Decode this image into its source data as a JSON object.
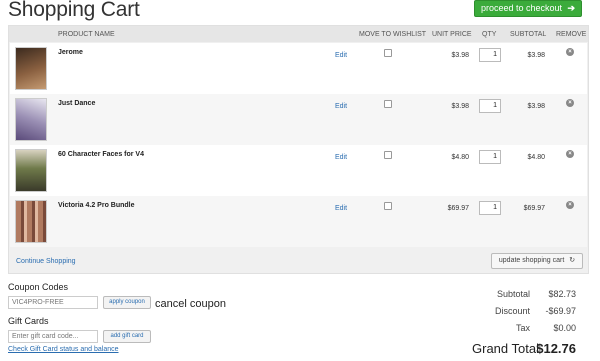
{
  "header": {
    "title": "Shopping Cart",
    "checkout_label": "proceed to checkout",
    "checkout_arrow": "➔"
  },
  "table": {
    "columns": {
      "product": "PRODUCT NAME",
      "wishlist": "MOVE TO WISHLIST",
      "unit_price": "UNIT PRICE",
      "qty": "QTY",
      "subtotal": "SUBTOTAL",
      "remove": "REMOVE"
    },
    "items": [
      {
        "name": "Jerome",
        "edit": "Edit",
        "unit_price": "$3.98",
        "qty": "1",
        "subtotal": "$3.98",
        "thumb_color": "#7a5a3c"
      },
      {
        "name": "Just Dance",
        "edit": "Edit",
        "unit_price": "$3.98",
        "qty": "1",
        "subtotal": "$3.98",
        "thumb_color": "#9a8fb4"
      },
      {
        "name": "60 Character Faces for V4",
        "edit": "Edit",
        "unit_price": "$4.80",
        "qty": "1",
        "subtotal": "$4.80",
        "thumb_color": "#6f7a4a"
      },
      {
        "name": "Victoria 4.2 Pro Bundle",
        "edit": "Edit",
        "unit_price": "$69.97",
        "qty": "1",
        "subtotal": "$69.97",
        "thumb_color": "#b07a60"
      }
    ],
    "continue_label": "Continue Shopping",
    "update_label": "update shopping cart",
    "update_icon": "↻"
  },
  "coupon": {
    "heading": "Coupon Codes",
    "value": "VIC4PRO-FREE",
    "apply_label": "apply coupon",
    "cancel_label": "cancel coupon"
  },
  "gift": {
    "heading": "Gift Cards",
    "placeholder": "Enter gift card code...",
    "add_label": "add gift card",
    "status_link": "Check Gift Card status and balance"
  },
  "totals": {
    "subtotal_label": "Subtotal",
    "subtotal": "$82.73",
    "discount_label": "Discount",
    "discount": "-$69.97",
    "tax_label": "Tax",
    "tax": "$0.00",
    "grand_label": "Grand Total",
    "grand": "$12.76"
  },
  "colors": {
    "accent_green": "#3bab3b",
    "link_blue": "#2a6db0"
  }
}
